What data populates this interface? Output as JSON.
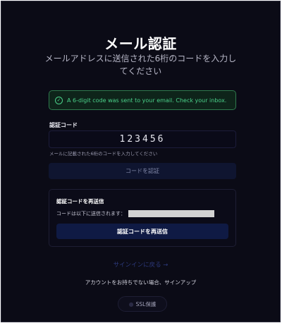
{
  "page": {
    "title": "メール認証",
    "subtitle": "メールアドレスに送信された6桁のコードを入力してください"
  },
  "alert": {
    "icon": "check-circle-icon",
    "color": "#4bd18a",
    "message": "A 6-digit code was sent to your email. Check your inbox."
  },
  "form": {
    "code_label": "認証コード",
    "code_value": "123456",
    "hint": "メールに記載された6桁のコードを入力してください",
    "verify_button": "コードを認証"
  },
  "resend": {
    "title": "認証コードを再送信",
    "sent_to_label": "コードは以下に送信されます：",
    "button": "認証コードを再送信"
  },
  "footer": {
    "back_link": "サインインに戻る →",
    "signup": "アカウントをお持ちでない場合、サインアップ",
    "ssl_badge": "SSL保護",
    "ssl_icon": "lock-icon"
  },
  "colors": {
    "background": "#0b0b16",
    "success": "#4bd18a",
    "primary_button": "#0f1a44"
  }
}
